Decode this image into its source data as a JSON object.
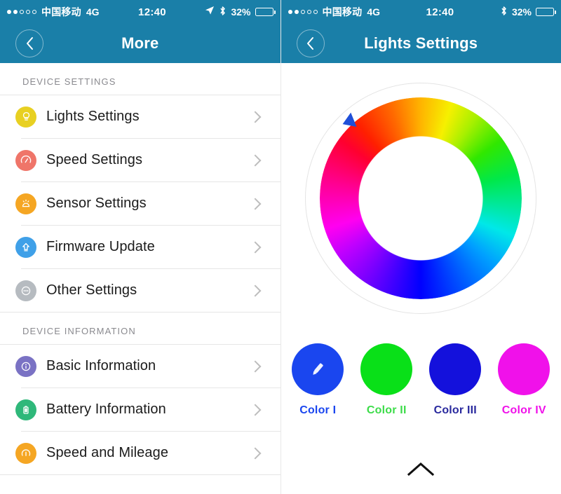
{
  "left": {
    "status": {
      "signal_dots": [
        true,
        true,
        false,
        false,
        false
      ],
      "carrier": "中国移动",
      "network": "4G",
      "time": "12:40",
      "location_icon": "location-arrow-icon",
      "bluetooth_icon": "bluetooth-icon",
      "battery_percent": "32%",
      "battery_level": 32
    },
    "nav": {
      "back_icon": "chevron-left-icon",
      "title": "More"
    },
    "sections": [
      {
        "header": "DEVICE SETTINGS",
        "items": [
          {
            "label": "Lights Settings",
            "icon": "lightbulb-icon",
            "color": "#e8d022"
          },
          {
            "label": "Speed Settings",
            "icon": "speedometer-icon",
            "color": "#ef7569"
          },
          {
            "label": "Sensor Settings",
            "icon": "sensor-icon",
            "color": "#f5a623"
          },
          {
            "label": "Firmware Update",
            "icon": "upload-arrow-icon",
            "color": "#3fa0e8"
          },
          {
            "label": "Other Settings",
            "icon": "ellipsis-icon",
            "color": "#b6bbc0"
          }
        ]
      },
      {
        "header": "DEVICE INFORMATION",
        "items": [
          {
            "label": "Basic Information",
            "icon": "info-icon",
            "color": "#7a72c4"
          },
          {
            "label": "Battery Information",
            "icon": "battery-icon",
            "color": "#2fb87a"
          },
          {
            "label": "Speed and Mileage",
            "icon": "gauge-icon",
            "color": "#f5a623"
          }
        ]
      }
    ]
  },
  "right": {
    "status": {
      "signal_dots": [
        true,
        true,
        false,
        false,
        false
      ],
      "carrier": "中国移动",
      "network": "4G",
      "time": "12:40",
      "bluetooth_icon": "bluetooth-icon",
      "battery_percent": "32%",
      "battery_level": 32
    },
    "nav": {
      "back_icon": "chevron-left-icon",
      "title": "Lights Settings"
    },
    "color_wheel": {
      "marker_icon": "wheel-marker-triangle",
      "marker_color": "#1f4fd8"
    },
    "swatches": [
      {
        "label": "Color I",
        "color": "#1a46ef",
        "icon": "pencil-icon"
      },
      {
        "label": "Color II",
        "color": "#09e018",
        "icon": null
      },
      {
        "label": "Color III",
        "color": "#1411dc",
        "icon": null
      },
      {
        "label": "Color IV",
        "color": "#f011ea",
        "icon": null
      }
    ],
    "bottom_action_icon": "chevron-up-icon"
  },
  "theme": {
    "header_bg": "#1a7fa8",
    "text_dark": "#1b1b1b",
    "text_muted": "#8a8a8f",
    "battery_fill": "#f5c518"
  }
}
